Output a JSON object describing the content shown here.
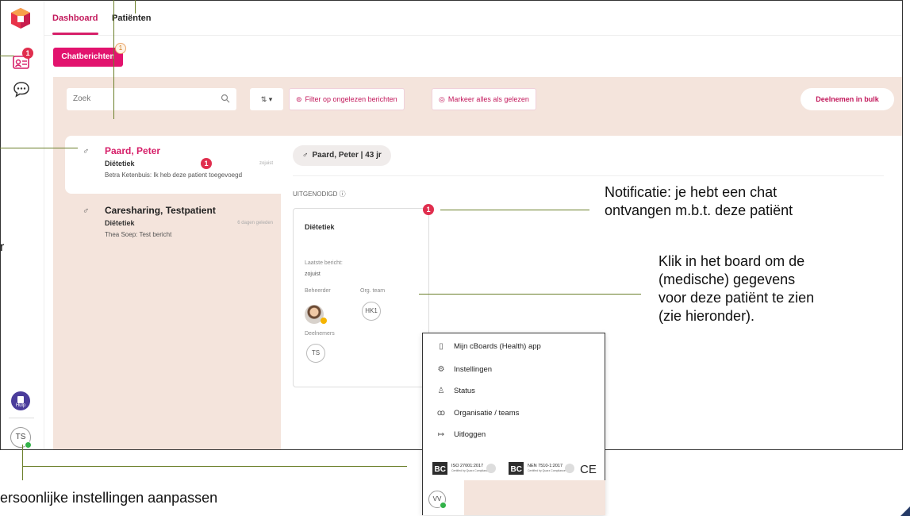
{
  "tabs": [
    "Dashboard",
    "Patiënten"
  ],
  "rail": {
    "notif_count": "1",
    "help_label": "Hulp",
    "user_initials": "TS"
  },
  "chat_button": {
    "label": "Chatberichten",
    "badge": "1"
  },
  "toolbar": {
    "search_placeholder": "Zoek",
    "filter_label": "Filter op ongelezen berichten",
    "mark_read_label": "Markeer alles als gelezen",
    "bulk_label": "Deelnemen in bulk"
  },
  "patients": [
    {
      "name": "Paard, Peter",
      "team": "Diëtetiek",
      "time": "zojuist",
      "message": "Betra Ketenbuis: Ik heb deze patient toegevoegd",
      "badge": "1",
      "gender": "♂"
    },
    {
      "name": "Caresharing, Testpatient",
      "team": "Diëtetiek",
      "time": "6 dagen geleden",
      "message": "Thea Soep: Test bericht",
      "gender": "♂"
    }
  ],
  "detail": {
    "patient_chip": "Paard, Peter | 43 jr",
    "invited_label": "UITGENODIGD ⓘ",
    "board": {
      "title": "Diëtetiek",
      "badge": "1",
      "last_msg_label": "Laatste bericht:",
      "last_msg_value": "zojuist",
      "owner_label": "Beheerder",
      "org_label": "Org. team",
      "org_value": "HK1",
      "participants_label": "Deelnemers",
      "participant": "TS"
    }
  },
  "menu": {
    "items": [
      "Mijn cBoards (Health) app",
      "Instellingen",
      "Status",
      "Organisatie / teams",
      "Uitloggen"
    ],
    "cert1_title": "ISO 27001:2017",
    "cert2_title": "NEN 7510-1:2017",
    "cert_sub": "Certified by Quarz Compliance",
    "ce": "CE",
    "user_initials": "VV"
  },
  "annotations": {
    "notif": [
      "Notificatie: je hebt een chat",
      "ontvangen m.b.t. deze patiënt"
    ],
    "board": [
      "Klik in het board om de",
      "(medische) gegevens",
      "voor deze patiënt te zien",
      "(zie hieronder)."
    ],
    "settings": "ersoonlijke instellingen aanpassen",
    "edge_r": "r"
  }
}
